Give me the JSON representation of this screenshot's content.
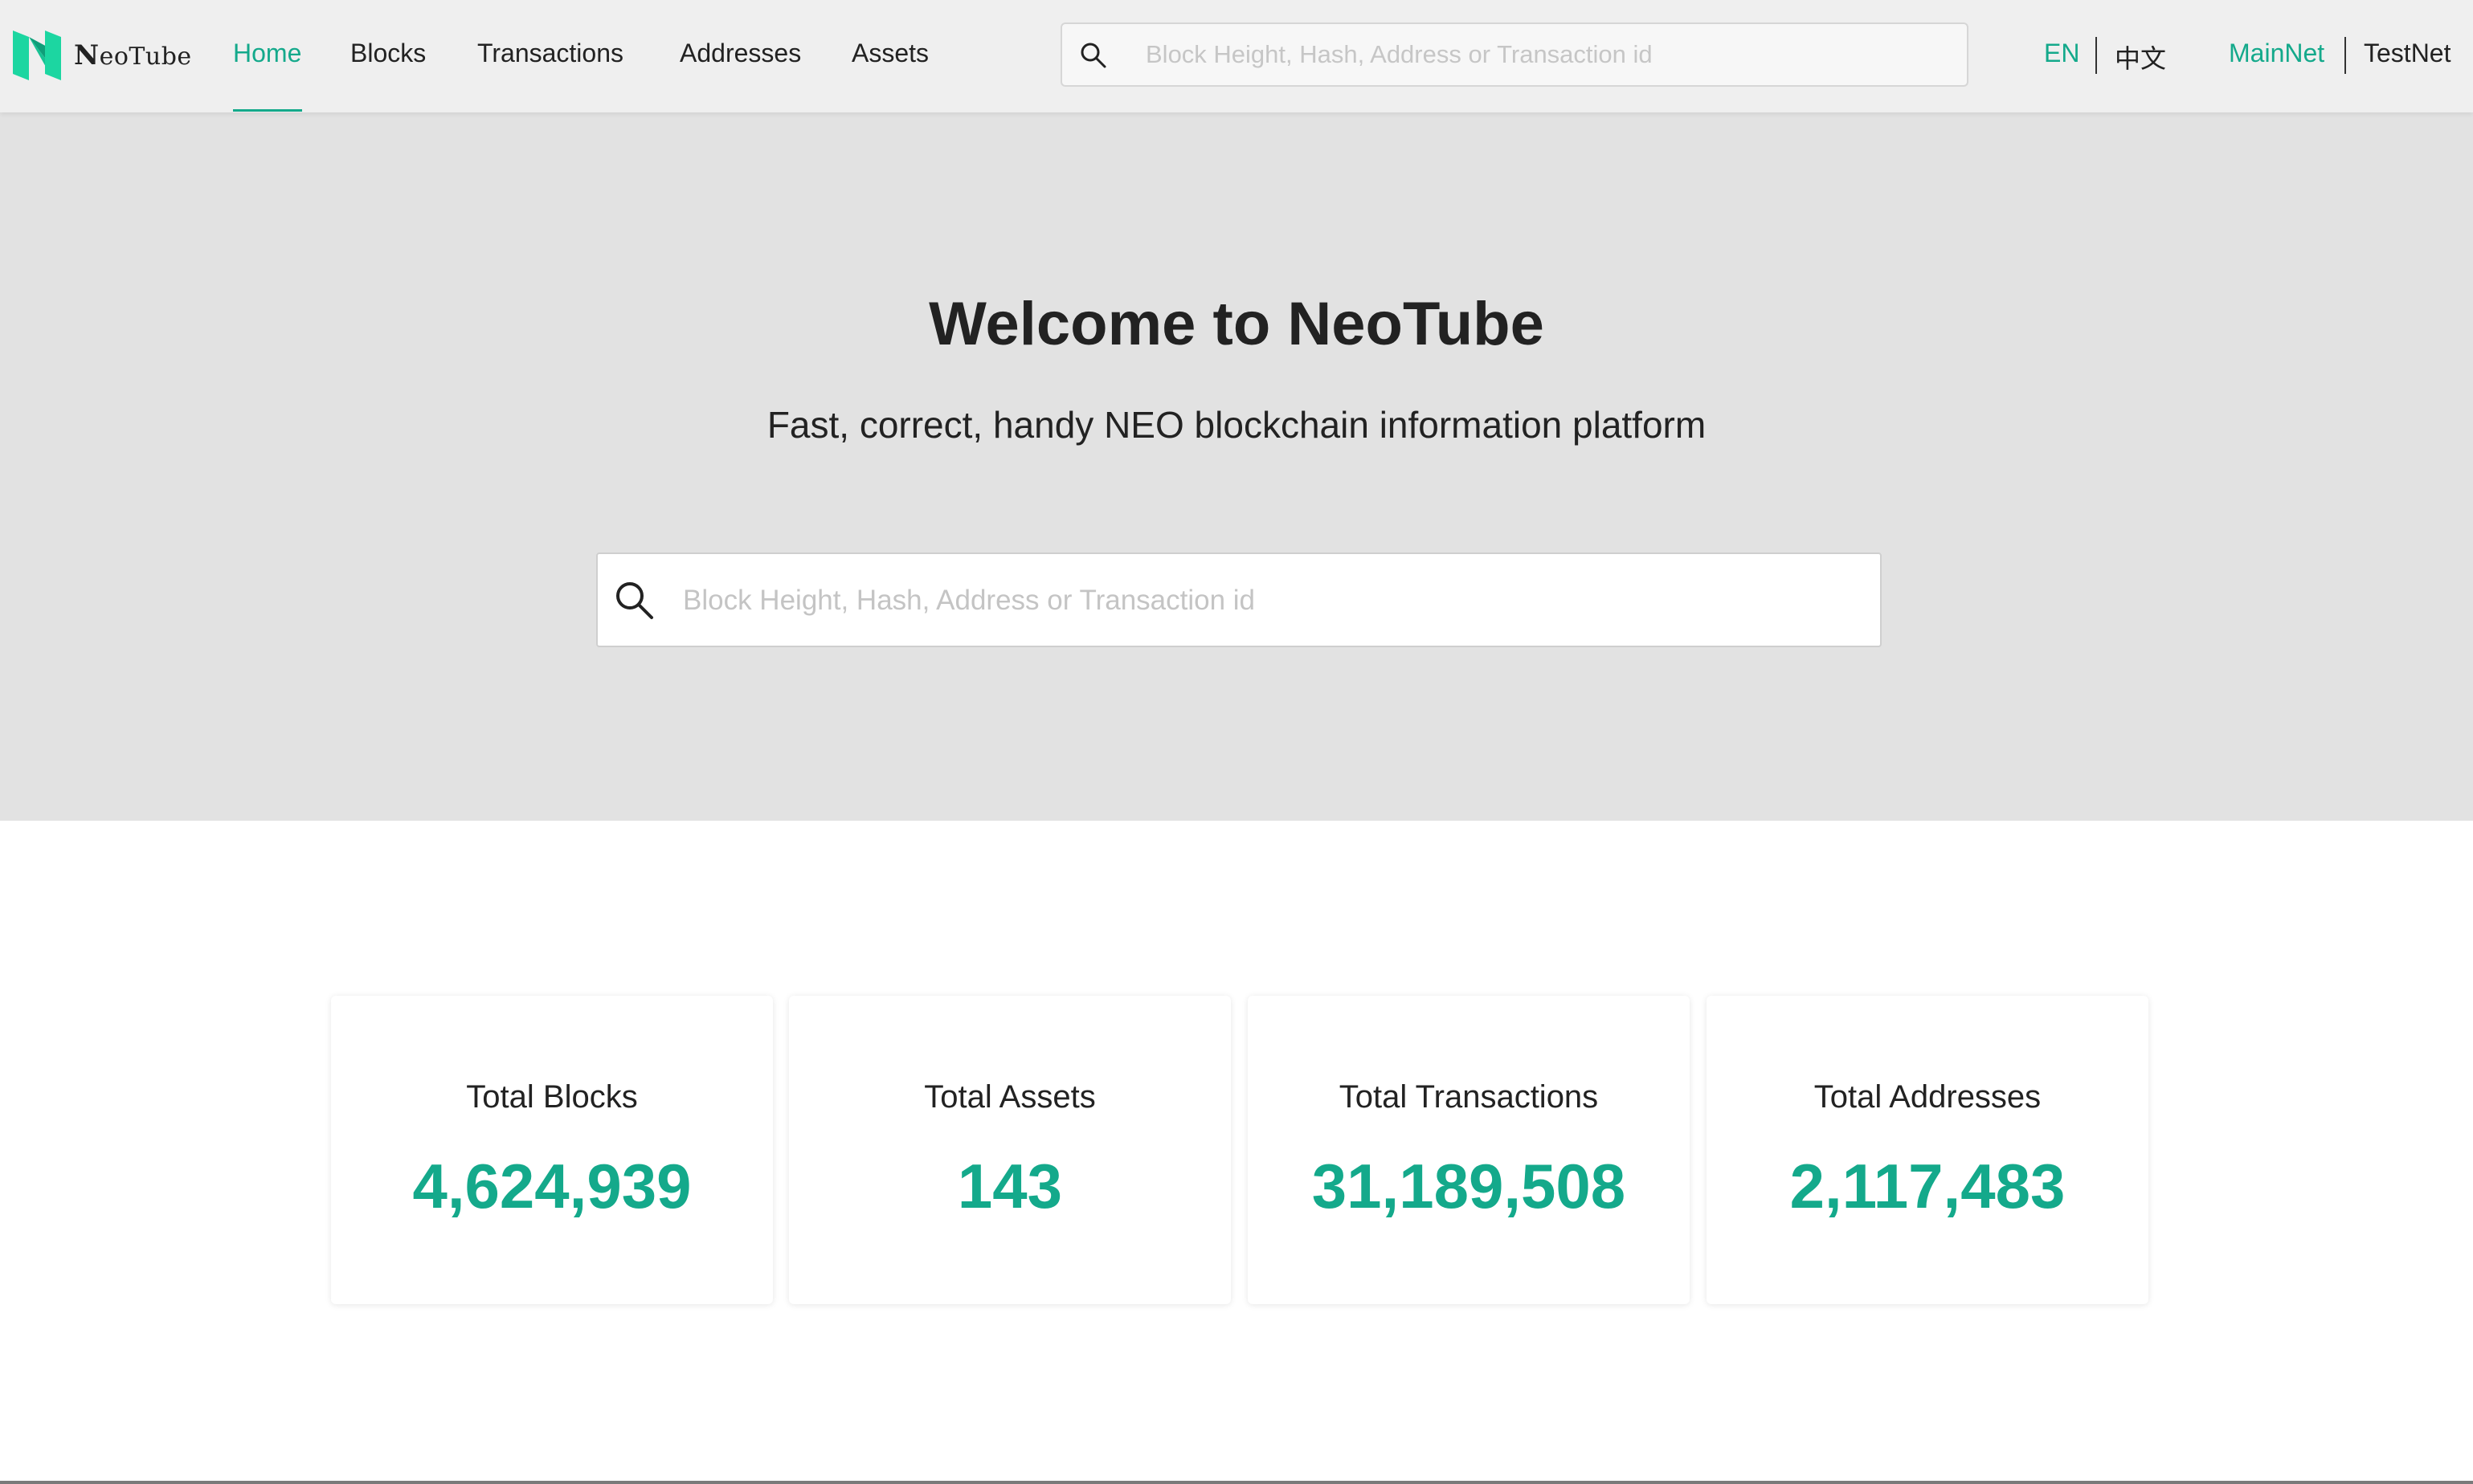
{
  "brand": {
    "name": "NeoTube",
    "name_initial": "N",
    "name_rest": "eoTube",
    "accent_color": "#14a98b",
    "logo_colors": [
      "#1cd6a1",
      "#0f9e79"
    ]
  },
  "nav": {
    "items": [
      {
        "label": "Home",
        "active": true
      },
      {
        "label": "Blocks",
        "active": false
      },
      {
        "label": "Transactions",
        "active": false
      },
      {
        "label": "Addresses",
        "active": false
      },
      {
        "label": "Assets",
        "active": false
      }
    ],
    "search": {
      "placeholder": "Block Height, Hash, Address or Transaction id",
      "value": "",
      "icon": "search-icon"
    },
    "languages": [
      {
        "label": "EN",
        "active": true
      },
      {
        "label": "中文",
        "active": false
      }
    ],
    "networks": [
      {
        "label": "MainNet",
        "active": true
      },
      {
        "label": "TestNet",
        "active": false
      }
    ]
  },
  "hero": {
    "title": "Welcome to NeoTube",
    "subtitle": "Fast, correct, handy NEO blockchain information platform",
    "search": {
      "placeholder": "Block Height, Hash, Address or Transaction id",
      "value": "",
      "icon": "search-icon"
    }
  },
  "stats": [
    {
      "label": "Total Blocks",
      "value": "4,624,939"
    },
    {
      "label": "Total Assets",
      "value": "143"
    },
    {
      "label": "Total Transactions",
      "value": "31,189,508"
    },
    {
      "label": "Total Addresses",
      "value": "2,117,483"
    }
  ]
}
